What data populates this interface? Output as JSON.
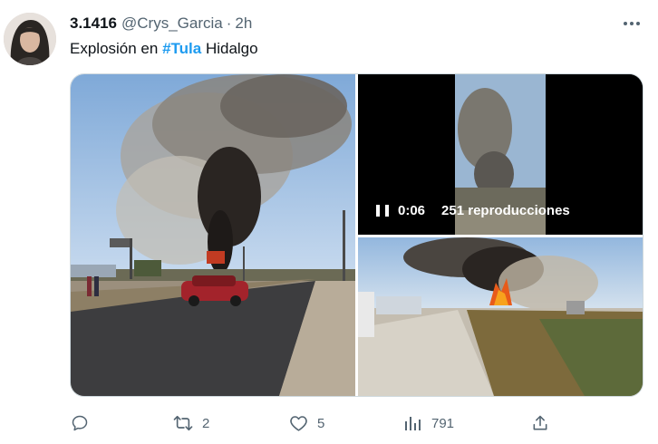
{
  "author": {
    "display_name": "3.1416",
    "handle": "@Crys_Garcia",
    "separator": "·",
    "time": "2h"
  },
  "tweet": {
    "text_before": "Explosión en ",
    "hashtag": "#Tula",
    "text_after": " Hidalgo"
  },
  "video": {
    "state": "playing",
    "elapsed": "0:06",
    "views": "251 reproducciones"
  },
  "actions": {
    "reply_count": "",
    "retweet_count": "2",
    "like_count": "5",
    "views_count": "791"
  },
  "colors": {
    "accent": "#1d9bf0",
    "muted": "#536471",
    "text": "#0f1419"
  },
  "icons": [
    "more-icon",
    "reply-icon",
    "retweet-icon",
    "like-icon",
    "views-icon",
    "share-icon",
    "pause-icon"
  ]
}
